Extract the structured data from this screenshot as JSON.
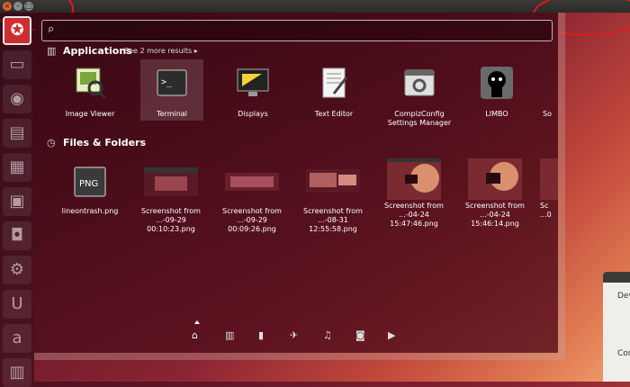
{
  "window": {
    "close_glyph": "×",
    "min_glyph": "–",
    "max_glyph": "□"
  },
  "search": {
    "placeholder": "",
    "value": "",
    "icon": "search-icon"
  },
  "applications": {
    "header": "Applications",
    "more_link": "See 2 more results ▸",
    "items": [
      {
        "label": "Image Viewer",
        "icon": "image-viewer-icon"
      },
      {
        "label": "Terminal",
        "icon": "terminal-icon",
        "selected": true
      },
      {
        "label": "Displays",
        "icon": "displays-icon"
      },
      {
        "label": "Text Editor",
        "icon": "text-editor-icon"
      },
      {
        "label": "CompizConfig\nSettings Manager",
        "icon": "compiz-icon"
      },
      {
        "label": "LIMBO",
        "icon": "limbo-icon"
      },
      {
        "label": "So",
        "icon": "partial-app-icon"
      }
    ]
  },
  "files": {
    "header": "Files & Folders",
    "items": [
      {
        "label": "lineontrash.png",
        "thumb_text": "PNG"
      },
      {
        "label": "Screenshot from\n...-09-29 00:10:23.png"
      },
      {
        "label": "Screenshot from\n...-09-29 00:09:26.png"
      },
      {
        "label": "Screenshot from\n...-08-31 12:55:58.png"
      },
      {
        "label": "Screenshot from\n...-04-24 15:47:46.png"
      },
      {
        "label": "Screenshot from\n...-04-24 15:46:14.png"
      },
      {
        "label": "Sc\n...0"
      }
    ]
  },
  "lenses": [
    {
      "name": "home-lens-icon",
      "glyph": "⌂",
      "active": true
    },
    {
      "name": "applications-lens-icon",
      "glyph": "▥"
    },
    {
      "name": "files-lens-icon",
      "glyph": "▮"
    },
    {
      "name": "social-lens-icon",
      "glyph": "✈"
    },
    {
      "name": "music-lens-icon",
      "glyph": "♫"
    },
    {
      "name": "photo-lens-icon",
      "glyph": "◙"
    },
    {
      "name": "video-lens-icon",
      "glyph": "▶"
    }
  ],
  "side_window": {
    "line1": "Dev",
    "line2": "Con"
  },
  "colors": {
    "accent": "#cc2f2f",
    "annotation": "#e2191b"
  }
}
